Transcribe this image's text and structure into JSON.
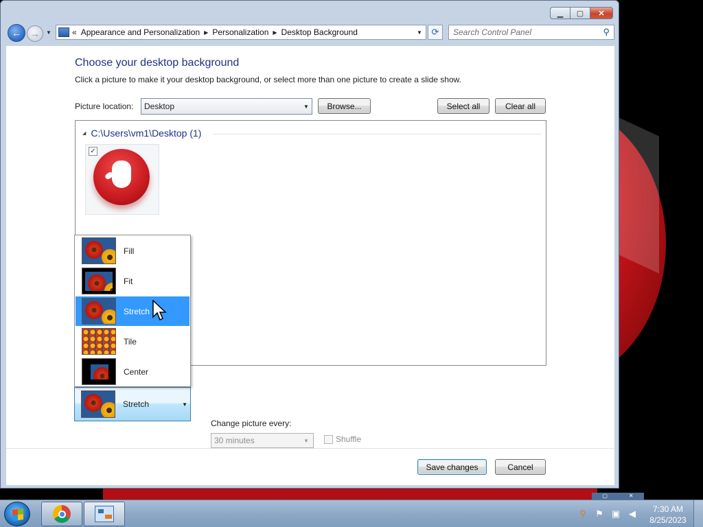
{
  "window": {
    "caption_buttons": [
      "minimize",
      "maximize",
      "close"
    ],
    "caption_glyphs": {
      "minimize": "▁",
      "maximize": "▢",
      "close": "✕"
    }
  },
  "nav": {
    "back_glyph": "←",
    "forward_glyph": "→",
    "overflow_glyph": "«",
    "breadcrumbs": [
      "Appearance and Personalization",
      "Personalization",
      "Desktop Background"
    ],
    "search_placeholder": "Search Control Panel"
  },
  "content": {
    "title": "Choose your desktop background",
    "description": "Click a picture to make it your desktop background, or select more than one picture to create a slide show.",
    "picture_location_label": "Picture location:",
    "picture_location_value": "Desktop",
    "browse_label": "Browse...",
    "select_all_label": "Select all",
    "clear_all_label": "Clear all",
    "group_header": "C:\\Users\\vm1\\Desktop (1)",
    "thumbnail_checked": true,
    "picture_position_options": [
      "Fill",
      "Fit",
      "Stretch",
      "Tile",
      "Center"
    ],
    "picture_position_selected": "Stretch",
    "change_picture_label": "Change picture every:",
    "change_picture_value": "30 minutes",
    "shuffle_label": "Shuffle",
    "save_label": "Save changes",
    "cancel_label": "Cancel"
  },
  "taskbar": {
    "apps": [
      "start",
      "chrome",
      "control-panel"
    ],
    "clock_time": "7:30 AM",
    "clock_date": "8/25/2023"
  },
  "colors": {
    "title_blue": "#1e3287",
    "selection_blue": "#3399ff",
    "wallpaper_red": "#c9151a"
  }
}
